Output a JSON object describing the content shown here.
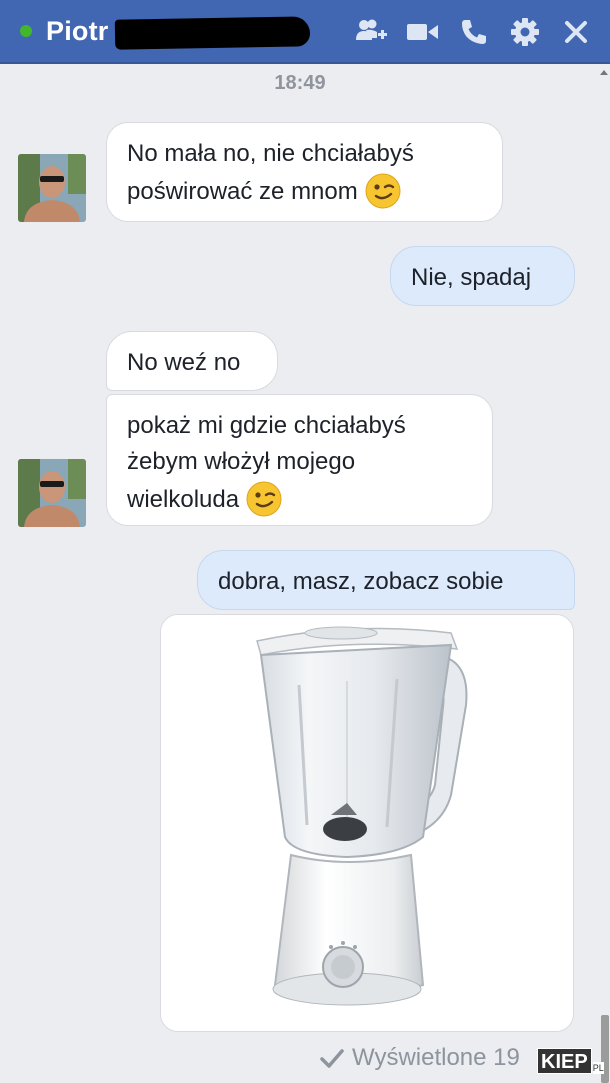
{
  "header": {
    "contact_name": "Piotr",
    "icons": [
      "add-people-icon",
      "video-call-icon",
      "phone-icon",
      "gear-icon",
      "close-icon"
    ],
    "colors": {
      "bar": "#4267b2",
      "online": "#42b72a"
    }
  },
  "conversation": {
    "timestamp": "18:49",
    "messages": [
      {
        "from": "contact",
        "lines": [
          "No mała no, nie chciałabyś",
          "poświrować ze mnom"
        ],
        "emoji": "wink-emoji"
      },
      {
        "from": "me",
        "lines": [
          "Nie, spadaj"
        ]
      },
      {
        "from": "contact",
        "lines": [
          "No weź no"
        ]
      },
      {
        "from": "contact",
        "lines": [
          "pokaż mi gdzie chciałabyś",
          "żebym włożył mojego",
          "wielkoluda"
        ],
        "emoji": "wink-emoji"
      },
      {
        "from": "me",
        "lines": [
          "dobra, masz, zobacz sobie"
        ]
      },
      {
        "from": "me",
        "attachment": "blender-photo"
      }
    ],
    "seen_status": "Wyświetlone 19"
  },
  "watermark": {
    "text": "KIEP",
    "suffix": "PL"
  },
  "colors": {
    "incoming_bubble": "#ffffff",
    "outgoing_bubble": "#dceafc",
    "background": "#ebedf0"
  }
}
